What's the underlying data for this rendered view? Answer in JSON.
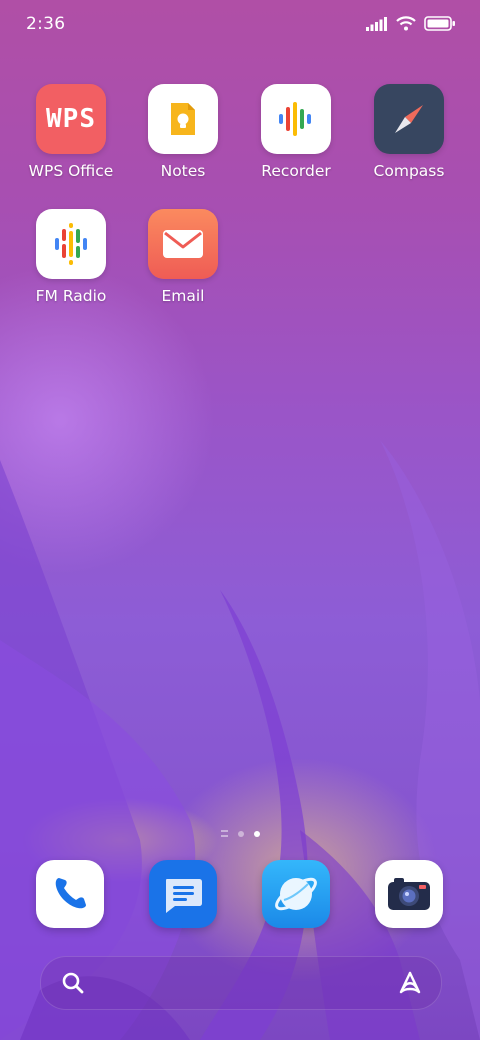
{
  "status_bar": {
    "time": "2:36"
  },
  "apps": [
    {
      "label": "WPS Office",
      "icon": "wps-office-icon",
      "logo_text": "WPS"
    },
    {
      "label": "Notes",
      "icon": "notes-icon"
    },
    {
      "label": "Recorder",
      "icon": "recorder-icon"
    },
    {
      "label": "Compass",
      "icon": "compass-icon"
    },
    {
      "label": "FM Radio",
      "icon": "fm-radio-icon"
    },
    {
      "label": "Email",
      "icon": "email-icon"
    }
  ],
  "page_indicator": {
    "pages": 2,
    "current": 2
  },
  "dock": [
    "phone-icon",
    "messages-icon",
    "browser-icon",
    "camera-icon"
  ],
  "colors": {
    "wps": "#f25f63",
    "compass_bg": "#374660",
    "email": "#f26a5a",
    "messages": "#1a73e8",
    "browser": "#2a9df4"
  }
}
